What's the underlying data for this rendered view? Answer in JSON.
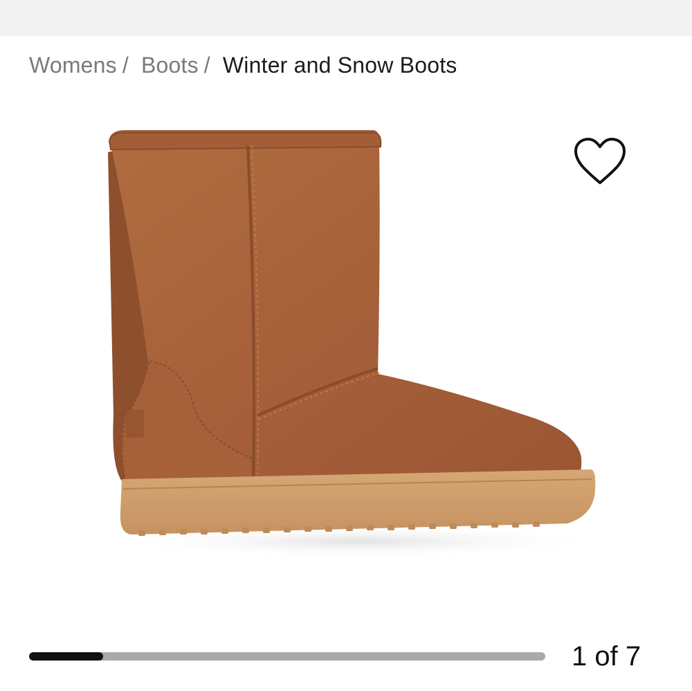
{
  "breadcrumb": {
    "items": [
      {
        "label": "Womens",
        "separator": "/"
      },
      {
        "label": "Boots",
        "separator": "/"
      }
    ],
    "current": "Winter and Snow Boots"
  },
  "product": {
    "image_alt": "brown suede winter boot with tan rubber sole",
    "colors": {
      "suede": "#a9653a",
      "sole": "#cf9d6b"
    }
  },
  "favorite": {
    "icon": "heart-outline-icon"
  },
  "gallery": {
    "current": 1,
    "total": 7,
    "counter_text": "1 of 7",
    "progress_fraction": 0.143
  }
}
